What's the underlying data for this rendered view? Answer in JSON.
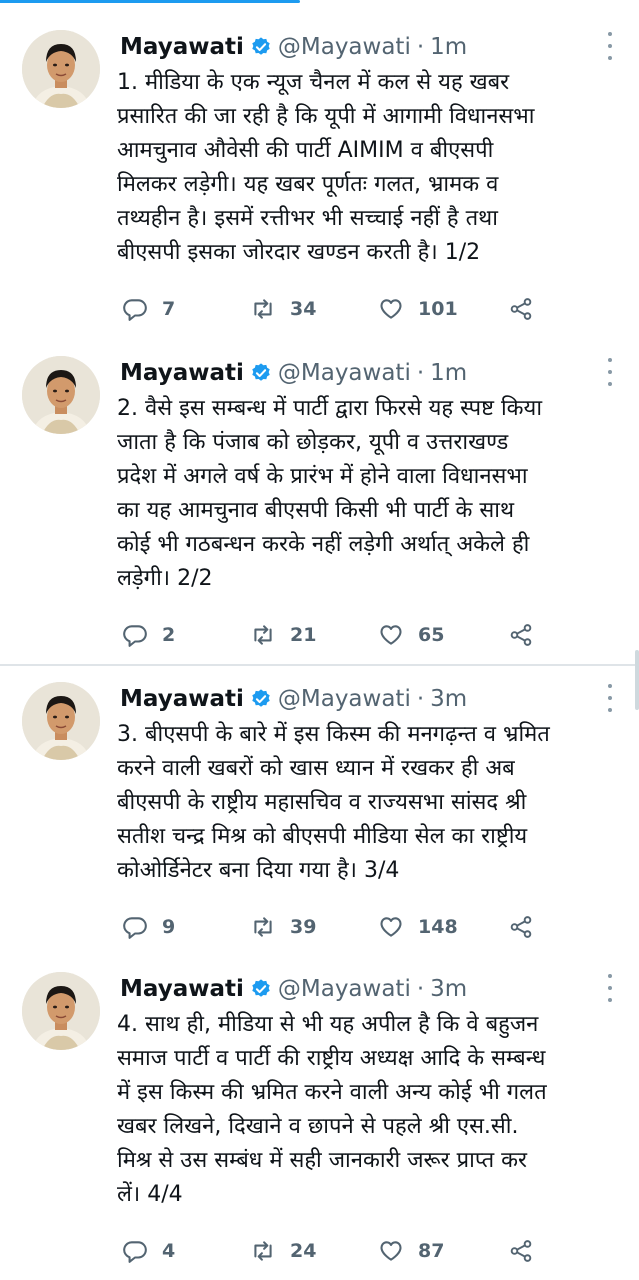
{
  "tweets": [
    {
      "name": "Mayawati",
      "handle": "@Mayawati",
      "dot": "·",
      "time": "1m",
      "text": "1. मीडिया के एक न्यूज चैनल में कल से यह खबर\nप्रसारित की जा रही है कि यूपी में आगामी विधानसभा\nआमचुनाव औवेसी की पार्टी AIMIM  व  बीएसपी\nमिलकर लड़ेगी। यह खबर पूर्णतः गलत, भ्रामक व\nतथ्यहीन है। इसमें रत्तीभर भी सच्चाई नहीं है तथा\nबीएसपी इसका जोरदार खण्डन करती है। 1/2",
      "replies": "7",
      "retweets": "34",
      "likes": "101"
    },
    {
      "name": "Mayawati",
      "handle": "@Mayawati",
      "dot": "·",
      "time": "1m",
      "text": "2. वैसे इस सम्बन्ध में पार्टी द्वारा फिरसे यह स्पष्ट किया\nजाता है कि पंजाब को छोड़कर, यूपी व उत्तराखण्ड\nप्रदेश में अगले वर्ष के प्रारंभ में होने वाला विधानसभा\nका यह आमचुनाव बीएसपी किसी भी पार्टी के साथ\nकोई भी गठबन्धन करके नहीं लड़ेगी अर्थात् अकेले ही\nलड़ेगी। 2/2",
      "replies": "2",
      "retweets": "21",
      "likes": "65"
    },
    {
      "name": "Mayawati",
      "handle": "@Mayawati",
      "dot": "·",
      "time": "3m",
      "text": "3. बीएसपी के बारे में इस किस्म की मनगढ़न्त व भ्रमित\nकरने वाली खबरों को खास ध्यान में रखकर ही अब\nबीएसपी के राष्ट्रीय महासचिव व राज्यसभा सांसद श्री\nसतीश चन्द्र मिश्र को बीएसपी मीडिया सेल का राष्ट्रीय\nकोओर्डिनेटर बना दिया गया है। 3/4",
      "replies": "9",
      "retweets": "39",
      "likes": "148"
    },
    {
      "name": "Mayawati",
      "handle": "@Mayawati",
      "dot": "·",
      "time": "3m",
      "text": "4. साथ ही, मीडिया से भी यह अपील है कि वे बहुजन\nसमाज पार्टी व पार्टी की राष्ट्रीय अध्यक्ष आदि के सम्बन्ध\nमें इस किस्म की भ्रमित करने वाली अन्य कोई भी गलत\nखबर लिखने, दिखाने व छापने से पहले श्री एस.सी.\nमिश्र से उस सम्बंध में सही जानकारी जरूर प्राप्त कर\nलें।  4/4",
      "replies": "4",
      "retweets": "24",
      "likes": "87"
    }
  ],
  "colors": {
    "accent": "#1d9bf0",
    "secondary_text": "#536471"
  },
  "icons": [
    "verified-badge-icon",
    "more-options-icon",
    "reply-icon",
    "retweet-icon",
    "like-icon",
    "share-icon"
  ]
}
